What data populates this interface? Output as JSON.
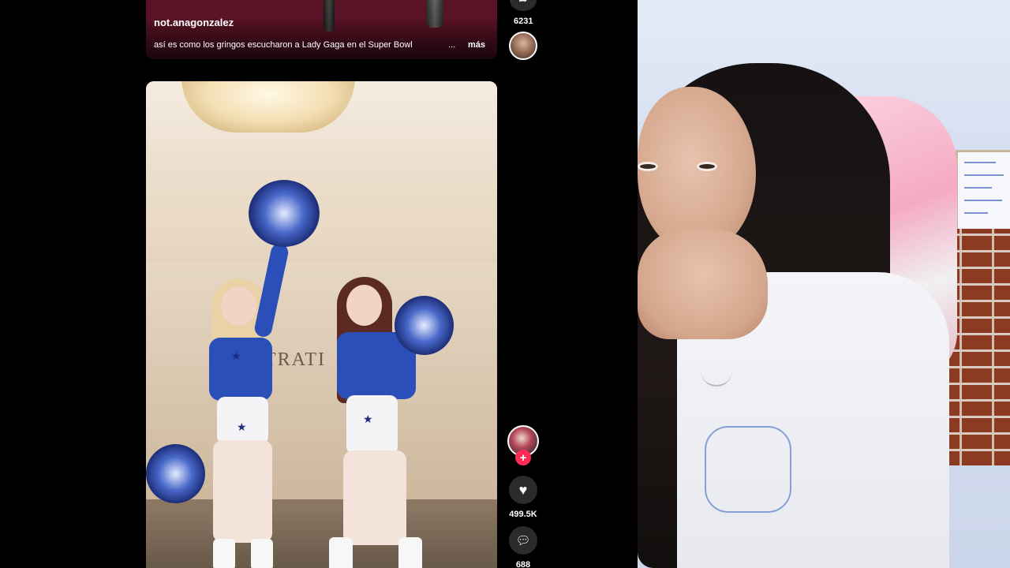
{
  "feed": {
    "previous_video": {
      "author": "not.anagonzalez",
      "caption": "así es como los gringos escucharon a Lady Gaga en el Super Bowl",
      "caption_emoji_icon": "emoji-icon",
      "ellipsis": "...",
      "more_label": "más",
      "share_count": "6231"
    },
    "current_video": {
      "sign_text": "TRATI",
      "actions": {
        "like_count": "499.5K",
        "comment_count": "688",
        "follow_icon": "plus-icon",
        "like_icon": "heart-icon",
        "comment_icon": "comment-bubble-icon",
        "share_icon": "share-arrow-icon"
      }
    }
  },
  "colors": {
    "follow_accent": "#fe2c55",
    "action_button_bg": "#2b2b2b",
    "background": "#000000"
  }
}
